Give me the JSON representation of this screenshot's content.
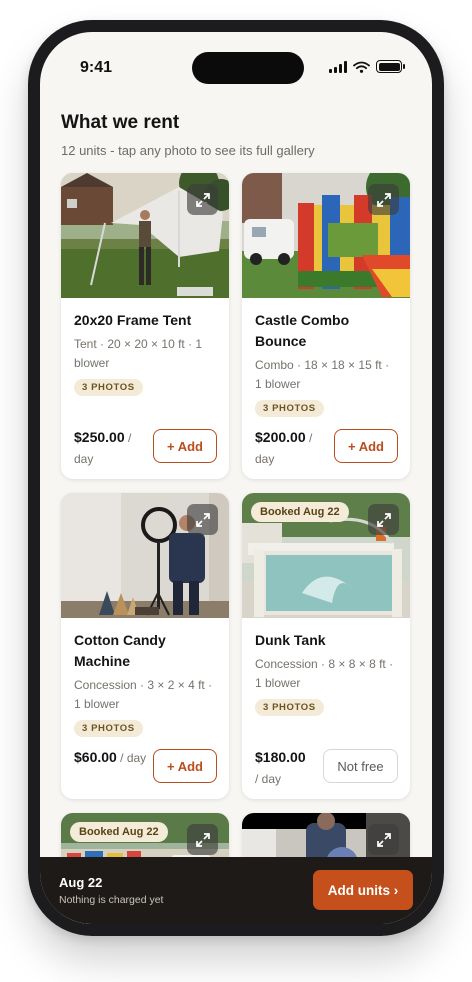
{
  "status": {
    "time": "9:41"
  },
  "header": {
    "title": "What we rent",
    "subtitle": "12 units - tap any photo to see its full gallery"
  },
  "units": [
    {
      "name": "20x20 Frame Tent",
      "specs": "Tent · 20 × 20 × 10 ft · 1 blower",
      "photos_badge": "3 PHOTOS",
      "price": "$250.00",
      "price_unit": " / day",
      "action": "+ Add"
    },
    {
      "name": "Castle Combo Bounce",
      "specs": "Combo · 18 × 18 × 15 ft · 1 blower",
      "photos_badge": "3 PHOTOS",
      "price": "$200.00",
      "price_unit": " / day",
      "action": "+ Add"
    },
    {
      "name": "Cotton Candy Machine",
      "specs": "Concession · 3 × 2 × 4 ft · 1 blower",
      "photos_badge": "3 PHOTOS",
      "price": "$60.00",
      "price_unit": " / day",
      "action": "+ Add"
    },
    {
      "name": "Dunk Tank",
      "specs": "Concession · 8 × 8 × 8 ft · 1 blower",
      "photos_badge": "3 PHOTOS",
      "price": "$180.00",
      "price_unit": " / day",
      "booked_badge": "Booked Aug 22",
      "action": "Not free"
    },
    {
      "booked_badge": "Booked Aug 22"
    },
    {}
  ],
  "bottom_bar": {
    "date": "Aug 22",
    "note": "Nothing is charged yet",
    "button": "Add units ›"
  },
  "colors": {
    "accent": "#c6501c",
    "accent_text": "#b84e1e",
    "badge_bg": "#f3ead7",
    "bar_bg": "#1d1a17"
  }
}
